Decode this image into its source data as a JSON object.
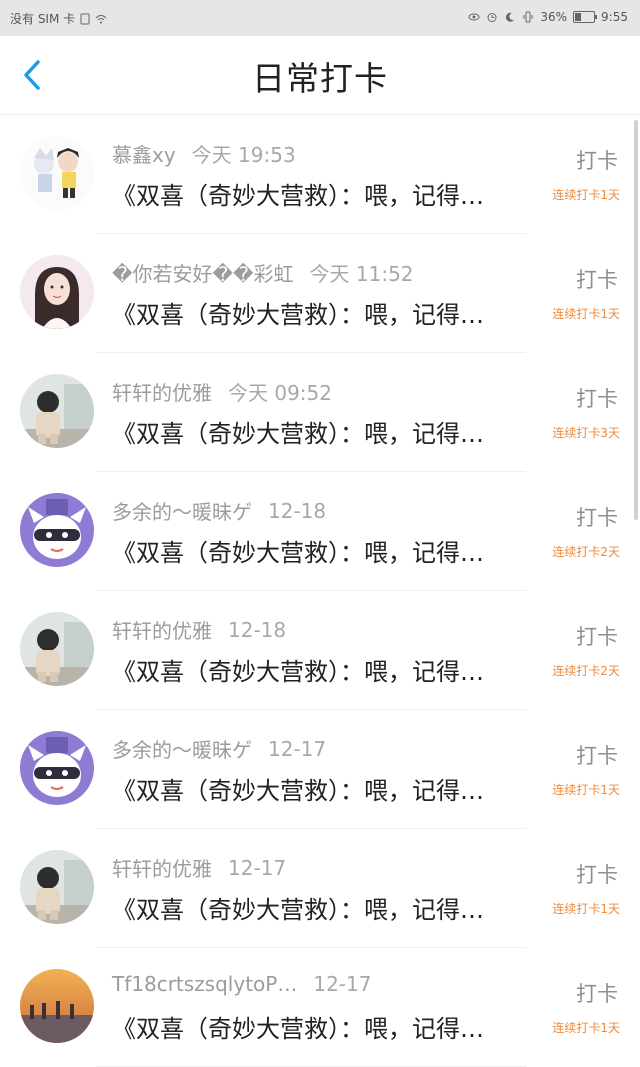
{
  "status_bar": {
    "carrier": "没有 SIM 卡",
    "battery": "36%",
    "battery_level": 0.36,
    "time": "9:55"
  },
  "header": {
    "title": "日常打卡",
    "back_icon": "chevron-left-icon"
  },
  "items": [
    {
      "name": "慕鑫xy",
      "time": "今天 19:53",
      "content": "《双喜（奇妙大营救）：喂，记得…",
      "checkin": "打卡",
      "streak": "连续打卡1天",
      "avatar": "anime-duo-avatar"
    },
    {
      "name": "�你若安好��彩虹",
      "time": "今天 11:52",
      "content": "《双喜（奇妙大营救）：喂，记得…",
      "checkin": "打卡",
      "streak": "连续打卡1天",
      "avatar": "girl-photo-avatar"
    },
    {
      "name": "轩轩的优雅",
      "time": "今天 09:52",
      "content": "《双喜（奇妙大营救）：喂，记得…",
      "checkin": "打卡",
      "streak": "连续打卡3天",
      "avatar": "child-photo-avatar"
    },
    {
      "name": "多余的～暖昧ゲ",
      "time": "12-18",
      "content": "《双喜（奇妙大营救）：喂，记得…",
      "checkin": "打卡",
      "streak": "连续打卡2天",
      "avatar": "cartoon-mask-avatar"
    },
    {
      "name": "轩轩的优雅",
      "time": "12-18",
      "content": "《双喜（奇妙大营救）：喂，记得…",
      "checkin": "打卡",
      "streak": "连续打卡2天",
      "avatar": "child-photo-avatar"
    },
    {
      "name": "多余的～暖昧ゲ",
      "time": "12-17",
      "content": "《双喜（奇妙大营救）：喂，记得…",
      "checkin": "打卡",
      "streak": "连续打卡1天",
      "avatar": "cartoon-mask-avatar"
    },
    {
      "name": "轩轩的优雅",
      "time": "12-17",
      "content": "《双喜（奇妙大营救）：喂，记得…",
      "checkin": "打卡",
      "streak": "连续打卡1天",
      "avatar": "child-photo-avatar"
    },
    {
      "name": "Tf18crtszsqlytoP…",
      "time": "12-17",
      "content": "《双喜（奇妙大营救）：喂，记得…",
      "checkin": "打卡",
      "streak": "连续打卡1天",
      "avatar": "sunset-photo-avatar"
    }
  ],
  "colors": {
    "accent": "#1e9be8",
    "streak": "#f08a3a"
  }
}
